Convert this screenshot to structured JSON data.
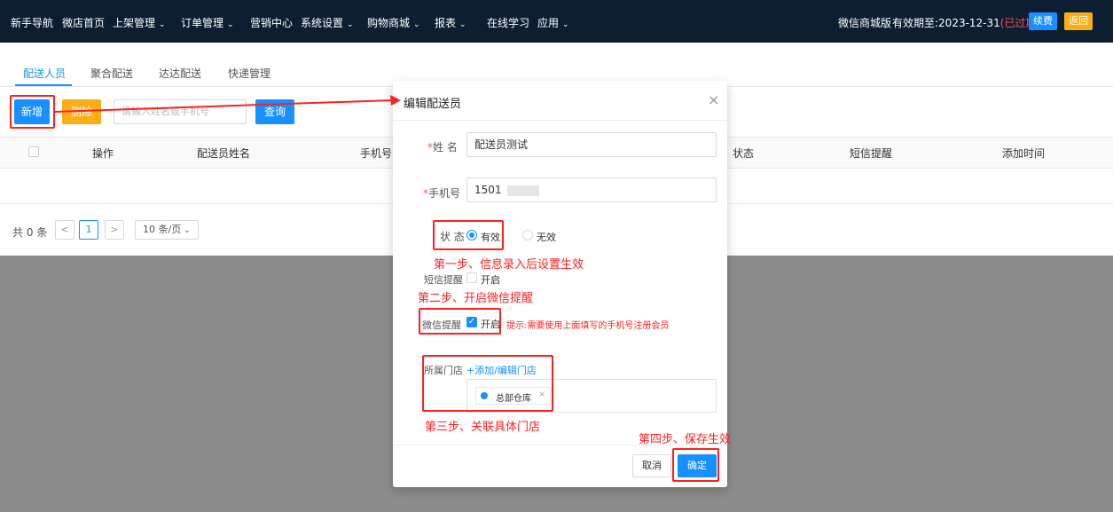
{
  "colors": {
    "nav_bg": "#0d1e33",
    "primary": "#1890ff",
    "warning": "#faad14",
    "danger": "#ff1f1f"
  },
  "nav": {
    "items": [
      {
        "label": "新手导航",
        "dropdown": false
      },
      {
        "label": "微店首页",
        "dropdown": false
      },
      {
        "label": "上架管理",
        "dropdown": true
      },
      {
        "label": "订单管理",
        "dropdown": true
      },
      {
        "label": "营销中心",
        "dropdown": false
      },
      {
        "label": "系统设置",
        "dropdown": true
      },
      {
        "label": "购物商城",
        "dropdown": true
      },
      {
        "label": "报表",
        "dropdown": true
      },
      {
        "label": "在线学习",
        "dropdown": false
      },
      {
        "label": "应用",
        "dropdown": true
      }
    ],
    "edition": "微信商城版",
    "expiry_prefix": "有效期至:2023-12-31",
    "expired": "(已过期)",
    "renew": "续费",
    "back": "返回"
  },
  "tabs": [
    "配送人员",
    "聚合配送",
    "达达配送",
    "快递管理"
  ],
  "toolbar": {
    "add": "新增",
    "delete": "删除",
    "search_placeholder": "请输入姓名或手机号",
    "query": "查询"
  },
  "table": {
    "headers": [
      "操作",
      "配送员姓名",
      "手机号",
      "状态",
      "短信提醒",
      "添加时间"
    ]
  },
  "pager": {
    "total": "共 0 条",
    "prev": "<",
    "current": "1",
    "next": ">",
    "size": "10 条/页"
  },
  "modal": {
    "title": "编辑配送员",
    "close": "×",
    "name_label": "姓 名",
    "name_value": "配送员测试",
    "phone_label": "手机号",
    "phone_value": "1501",
    "status_label": "状 态",
    "status_on": "有效",
    "status_off": "无效",
    "sms_label": "短信提醒",
    "sms_option": "开启",
    "wechat_label": "微信提醒",
    "wechat_option": "开启",
    "wechat_tip": "提示:需要使用上面填写的手机号注册会员",
    "store_label": "所属门店",
    "store_link": "+添加/编辑门店",
    "store_tag": "总部仓库",
    "store_tag_close": "×",
    "cancel": "取消",
    "ok": "确定"
  },
  "annotations": {
    "step1": "第一步、信息录入后设置生效",
    "step2": "第二步、开启微信提醒",
    "step3": "第三步、关联具体门店",
    "step4": "第四步、保存生效"
  }
}
